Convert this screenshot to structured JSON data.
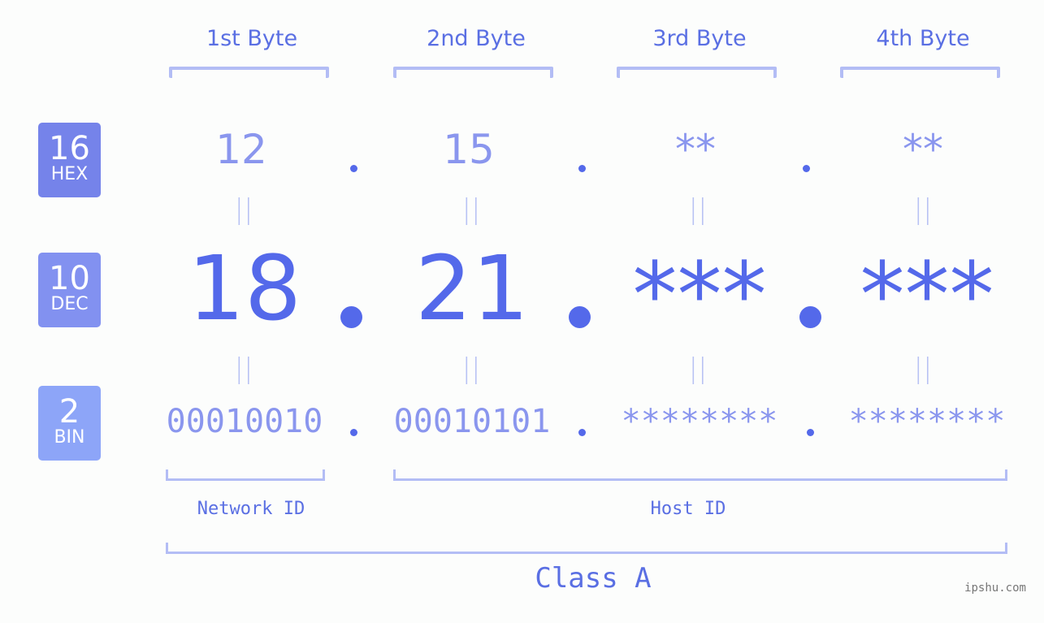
{
  "byte_headers": [
    "1st Byte",
    "2nd Byte",
    "3rd Byte",
    "4th Byte"
  ],
  "rows": {
    "hex": {
      "base": "16",
      "label": "HEX",
      "values": [
        "12",
        "15",
        "**",
        "**"
      ],
      "color": "#7583ea"
    },
    "dec": {
      "base": "10",
      "label": "DEC",
      "values": [
        "18",
        "21",
        "***",
        "***"
      ],
      "color": "#8291f0"
    },
    "bin": {
      "base": "2",
      "label": "BIN",
      "values": [
        "00010010",
        "00010101",
        "********",
        "********"
      ],
      "color": "#8da5f8"
    }
  },
  "separator": ".",
  "equals": "||",
  "network_id_label": "Network ID",
  "host_id_label": "Host ID",
  "class_label": "Class A",
  "watermark": "ipshu.com"
}
